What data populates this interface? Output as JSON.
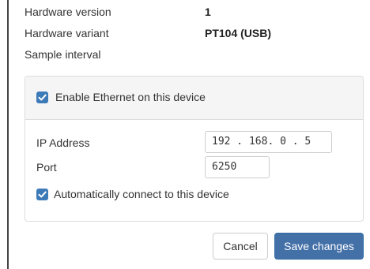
{
  "device_info": {
    "rows": [
      {
        "label": "Hardware version",
        "value": "1"
      },
      {
        "label": "Hardware variant",
        "value": "PT104 (USB)"
      },
      {
        "label": "Sample interval",
        "value": ""
      }
    ]
  },
  "ethernet_panel": {
    "enable_label": "Enable Ethernet on this device",
    "enable_checked": true,
    "ip_label": "IP Address",
    "ip_value": "192 . 168.  0  .  5",
    "port_label": "Port",
    "port_value": "6250",
    "auto_connect_label": "Automatically connect to this device",
    "auto_connect_checked": true
  },
  "footer": {
    "cancel_label": "Cancel",
    "save_label": "Save changes"
  },
  "colors": {
    "accent": "#4470a8",
    "checkbox": "#3d7ab8",
    "panel_heading_bg": "#f5f5f5"
  }
}
